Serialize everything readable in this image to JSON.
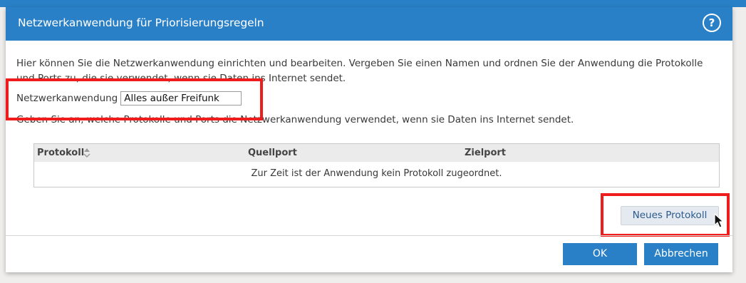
{
  "colors": {
    "accent": "#2a80c7",
    "highlight": "#ee1c1c",
    "secondary_button_bg": "#e5eaf1",
    "secondary_button_text": "#2a5b8c"
  },
  "dialog": {
    "title": "Netzwerkanwendung für Priorisierungsregeln",
    "help_icon": "help-icon",
    "description": "Hier können Sie die Netzwerkanwendung einrichten und bearbeiten. Vergeben Sie einen Namen und ordnen Sie der Anwendung die Protokolle und Ports zu, die sie verwendet, wenn sie Daten ins Internet sendet.",
    "app_label": "Netzwerkanwendung",
    "app_value": "Alles außer Freifunk",
    "description2": "Geben Sie an, welche Protokolle und Ports die Netzwerkanwendung verwendet, wenn sie Daten ins Internet sendet."
  },
  "table": {
    "columns": [
      "Protokoll",
      "Quellport",
      "Zielport"
    ],
    "sort_icon": "sort-icon",
    "empty_message": "Zur Zeit ist der Anwendung kein Protokoll zugeordnet."
  },
  "buttons": {
    "new_protocol": "Neues Protokoll",
    "ok": "OK",
    "cancel": "Abbrechen"
  }
}
